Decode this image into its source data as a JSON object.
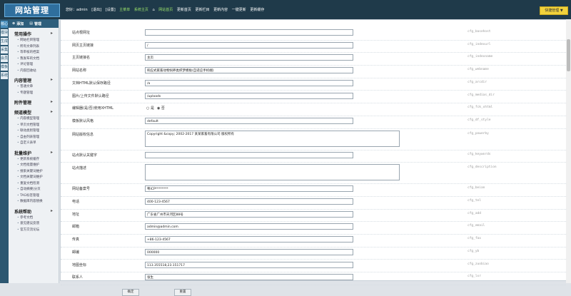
{
  "header": {
    "logo": "网站管理",
    "nav": [
      "您好：admin",
      "[退出]",
      "[设置]",
      "主菜单",
      "系统主页",
      "网站首页",
      "更新首页",
      "更新栏目",
      "更新内容",
      "一键更新",
      "更新缓存"
    ],
    "quick_button": "快捷管理 ▼"
  },
  "left_tabs": [
    "核心",
    "模块",
    "生成",
    "采集",
    "会员",
    "模板",
    "系统"
  ],
  "sidebar": {
    "add_button": "添加",
    "manage_button": "管理",
    "groups": [
      {
        "title": "常用操作",
        "items": [
          "网站栏目管理",
          "所有文章列表",
          "等审核的档案",
          "我发布的文档",
          "评论管理",
          "内容回收站"
        ]
      },
      {
        "title": "内容管理",
        "items": [
          "普通文章",
          "专题管理"
        ]
      },
      {
        "title": "附件管理",
        "items": []
      },
      {
        "title": "频道模型",
        "items": [
          "内容模型管理",
          "单页文档管理",
          "联动类别管理",
          "自由列表管理",
          "自定义表单"
        ]
      },
      {
        "title": "批量维护",
        "items": [
          "更新系统缓存",
          "文档批量维护",
          "搜索关键词维护",
          "文档关键词维护",
          "重复文档检测",
          "自动摘要|分页",
          "TAG标签管理",
          "数据库内容替换"
        ]
      },
      {
        "title": "系统帮助",
        "items": [
          "参考文档",
          "意见建议反馈",
          "官方交流论坛"
        ]
      }
    ]
  },
  "form": {
    "rows": [
      {
        "label": "站点根网址",
        "value": "",
        "code": "cfg_basehost"
      },
      {
        "label": "网页主页链接",
        "value": "/",
        "code": "cfg_indexurl"
      },
      {
        "label": "主页链接名",
        "value": "主页",
        "code": "cfg_indexname"
      },
      {
        "label": "网站名称",
        "value": "响应式家畜动物饲养类织梦模板(自适应手机端)",
        "code": "cfg_webname"
      },
      {
        "label": "文档HTML默认保存路径",
        "value": "/a",
        "code": "cfg_arcdir"
      },
      {
        "label": "图片/上传文件默认路径",
        "value": "/uploads",
        "code": "cfg_medias_dir"
      },
      {
        "label": "编辑器(是/否)使用XHTML",
        "type": "radio",
        "options": [
          "是",
          "否"
        ],
        "selected": "否",
        "code": "cfg_fck_xhtml"
      },
      {
        "label": "模板默认风格",
        "value": "default",
        "code": "cfg_df_style"
      },
      {
        "label": "网站版权信息",
        "type": "textarea",
        "value": "Copyright &copy; 2002-2017 某某家畜有限公司 版权所有",
        "code": "cfg_powerby"
      },
      {
        "label": "站点默认关键字",
        "value": "",
        "code": "cfg_keywords"
      },
      {
        "label": "站点描述",
        "type": "textarea",
        "value": "",
        "code": "cfg_description"
      },
      {
        "label": "网站备案号",
        "value": "粤ICP********",
        "code": "cfg_beian"
      },
      {
        "label": "电话",
        "value": "400-123-4567",
        "code": "cfg_tel"
      },
      {
        "label": "地址",
        "value": "广东省广州市天河区88号",
        "code": "cfg_add"
      },
      {
        "label": "邮箱",
        "value": "admin@admin.com",
        "code": "cfg_email"
      },
      {
        "label": "传真",
        "value": "+86-123-4567",
        "code": "cfg_fax"
      },
      {
        "label": "邮编",
        "value": "000000",
        "code": "cfg_yb"
      },
      {
        "label": "地图坐标",
        "value": "113.355518,23.151717",
        "code": "cfg_zuobiao"
      },
      {
        "label": "联系人",
        "value": "张生",
        "code": "cfg_lxr"
      }
    ],
    "submit_label": "确定",
    "reset_label": "重置"
  }
}
